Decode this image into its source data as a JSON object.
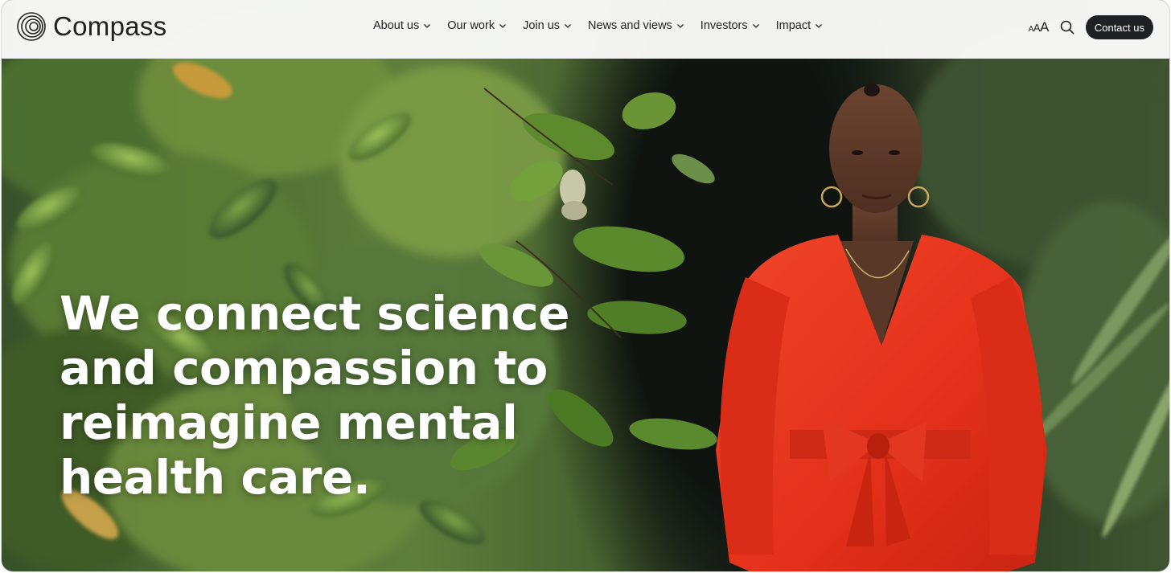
{
  "brand": {
    "logo_icon": "concentric-circles-logo-icon",
    "name": "Compass"
  },
  "nav": {
    "items": [
      {
        "label": "About us",
        "icon": "chevron-down-icon"
      },
      {
        "label": "Our work",
        "icon": "chevron-down-icon"
      },
      {
        "label": "Join us",
        "icon": "chevron-down-icon"
      },
      {
        "label": "News and views",
        "icon": "chevron-down-icon"
      },
      {
        "label": "Investors",
        "icon": "chevron-down-icon"
      },
      {
        "label": "Impact",
        "icon": "chevron-down-icon"
      }
    ],
    "font_size_toggle": {
      "small": "A",
      "medium": "A",
      "large": "A"
    },
    "search_icon": "search-icon",
    "contact_label": "Contact us"
  },
  "hero": {
    "headline": "We connect science\nand compassion to\nreimagine mental\nhealth care.",
    "image": "woman-in-red-dress-among-foliage"
  },
  "colors": {
    "nav_background": "#fafaf9",
    "button_dark": "#1f2124",
    "headline_text": "#ffffff",
    "dress_red": "#e8341e",
    "foliage_green": "#5f7f3c"
  }
}
